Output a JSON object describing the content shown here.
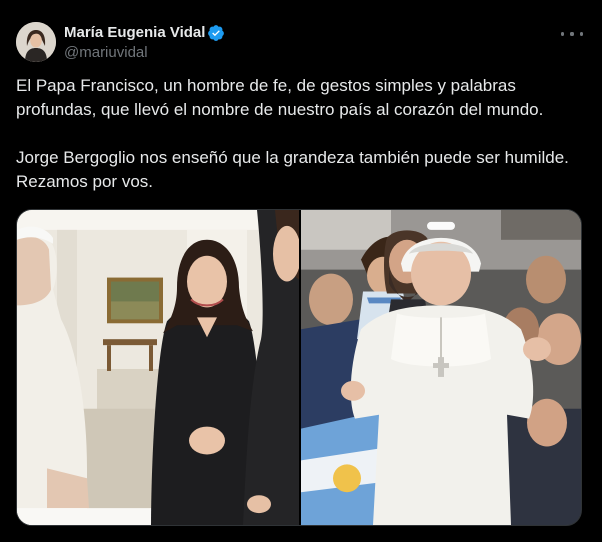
{
  "author": {
    "display_name": "María Eugenia Vidal",
    "handle": "@mariuvidal",
    "verified_badge": "verified-badge-icon",
    "verified_color": "#1d9bf0"
  },
  "menu": {
    "more_icon": "more-horizontal-icon"
  },
  "tweet": {
    "paragraph_1": "El Papa Francisco, un hombre de fe, de gestos simples y palabras profundas, que llevó el nombre de nuestro país al corazón del mundo.",
    "paragraph_2_line_1": "Jorge Bergoglio nos enseñó que la grandeza también puede ser humilde.",
    "paragraph_2_line_2": "Rezamos por vos."
  },
  "media": {
    "count": 2,
    "photos": [
      {
        "kind": "photo",
        "subject": "pope-meeting-photo"
      },
      {
        "kind": "photo",
        "subject": "pope-crowd-photo"
      }
    ]
  },
  "theme": {
    "background": "#000000",
    "text": "#e7e9ea",
    "muted": "#71767b",
    "border": "#2f3336"
  }
}
